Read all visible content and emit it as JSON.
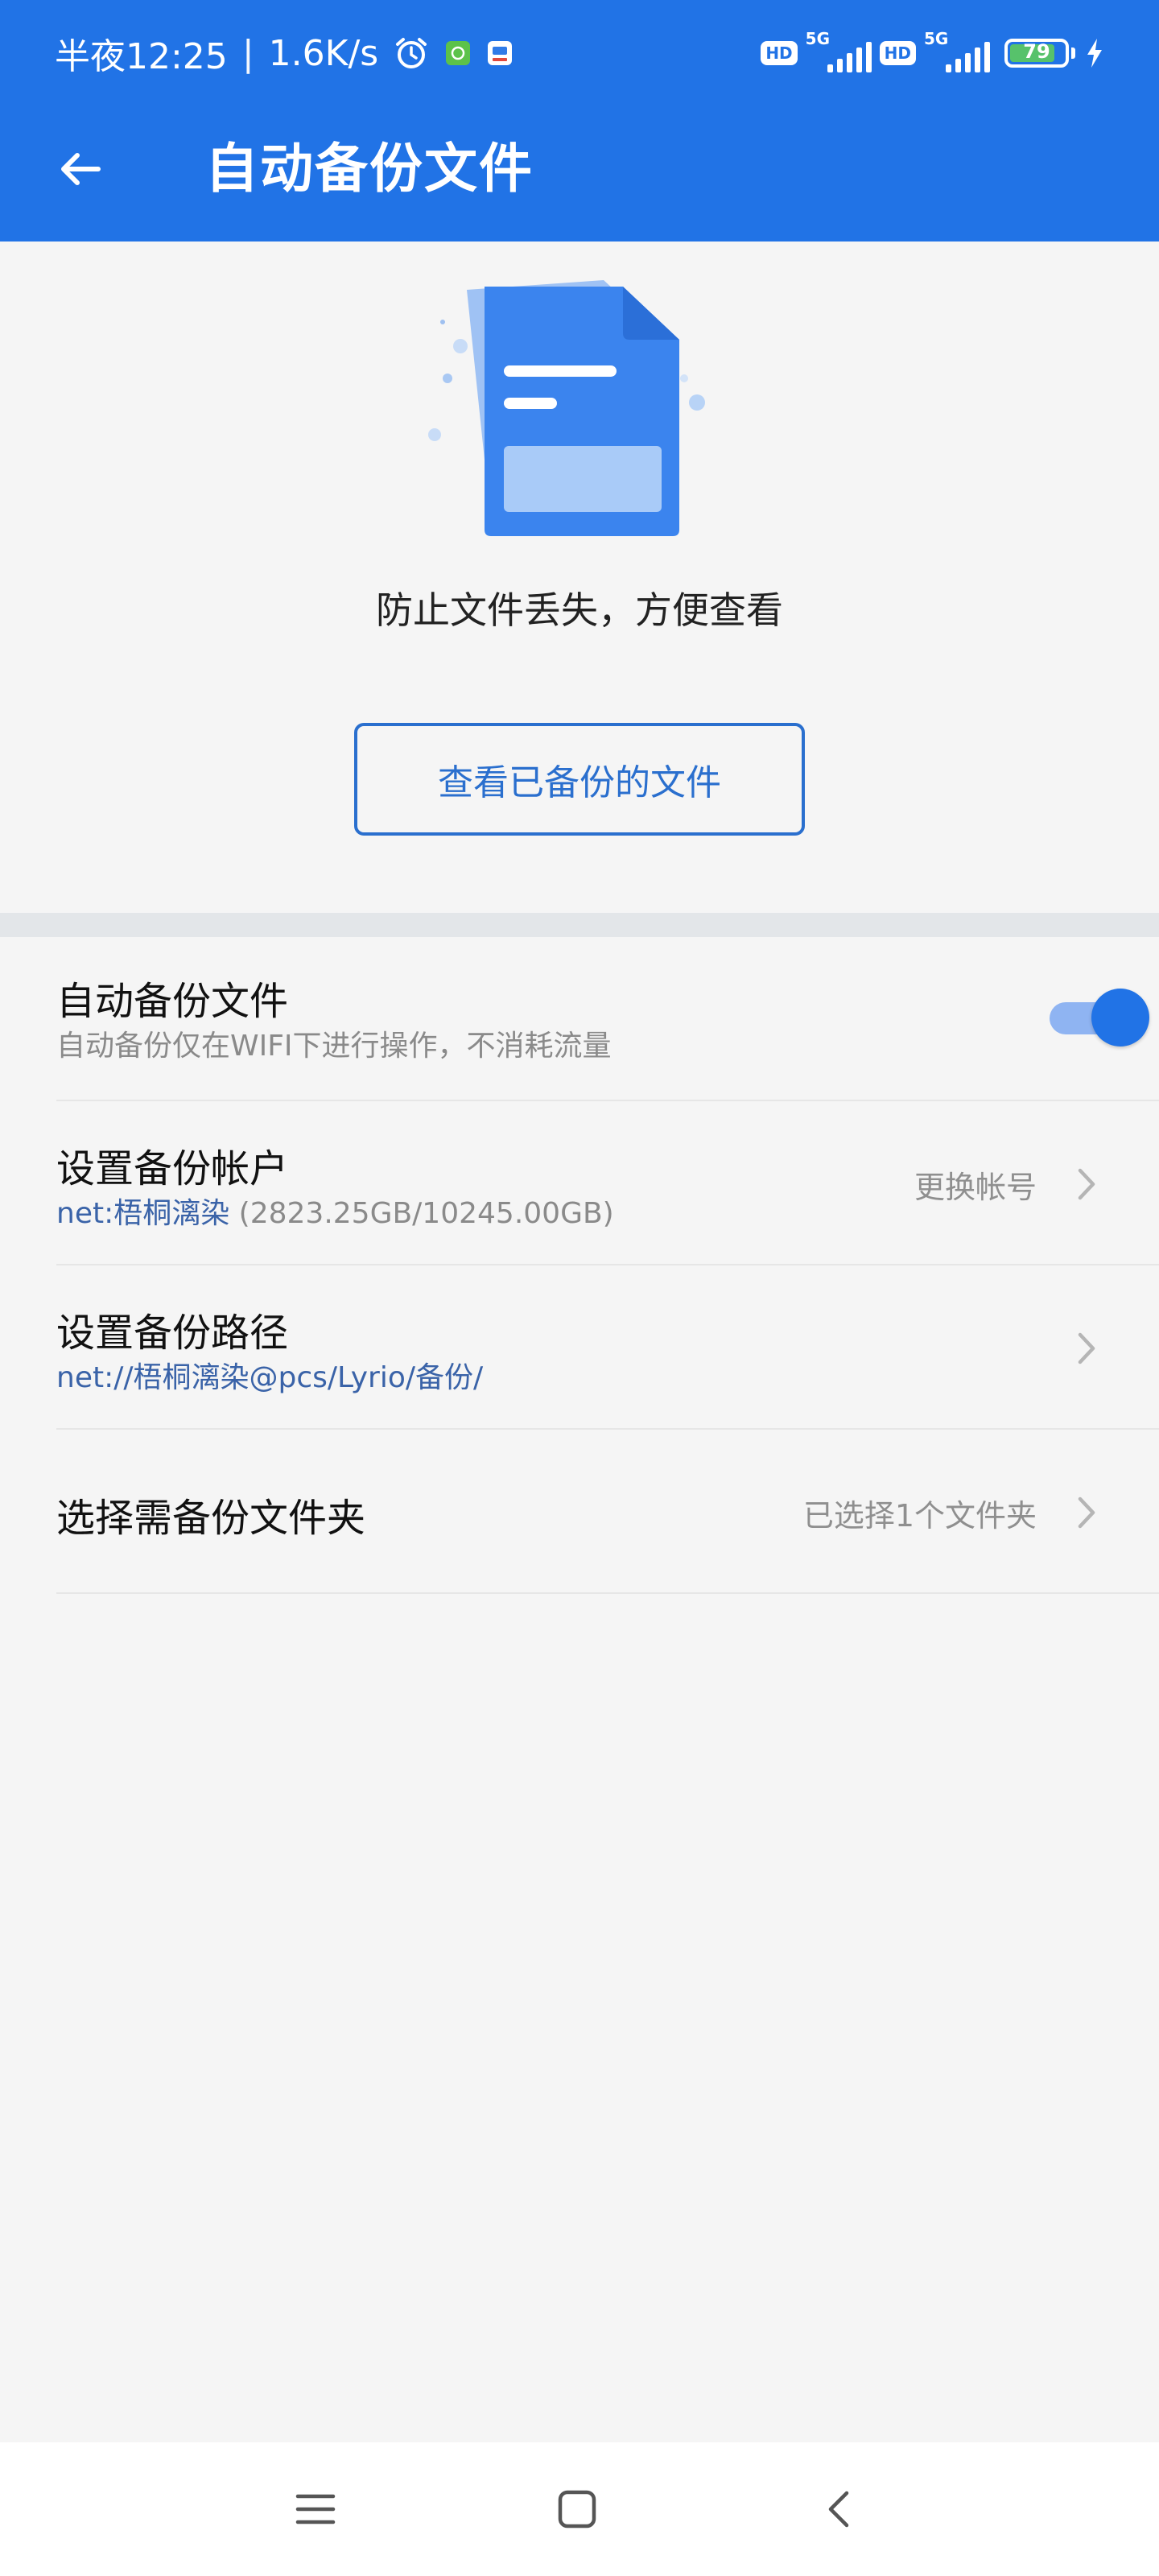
{
  "status_bar": {
    "time": "半夜12:25",
    "separator": "|",
    "speed": "1.6K/s",
    "hd_label": "HD",
    "network_label": "5G",
    "battery": "79",
    "icons": [
      "alarm-icon",
      "app-notification-icon",
      "app-notification-icon",
      "hd-icon",
      "5g-signal-icon",
      "hd-icon",
      "5g-signal-icon",
      "battery-icon",
      "charging-icon"
    ]
  },
  "app_bar": {
    "back_icon": "arrow-left-icon",
    "title": "自动备份文件"
  },
  "hero": {
    "illustration": "document-illustration",
    "tagline": "防止文件丢失，方便查看",
    "view_button": "查看已备份的文件"
  },
  "settings": {
    "auto_backup": {
      "title": "自动备份文件",
      "subtitle": "自动备份仅在WIFI下进行操作，不消耗流量",
      "enabled": true
    },
    "account": {
      "title": "设置备份帐户",
      "account_name": "net:梧桐漓染",
      "capacity": " (2823.25GB/10245.00GB)",
      "action": "更换帐号"
    },
    "path": {
      "title": "设置备份路径",
      "value": "net://梧桐漓染@pcs/Lyrio/备份/"
    },
    "folders": {
      "title": "选择需备份文件夹",
      "value": "已选择1个文件夹"
    }
  },
  "nav_bar": {
    "icons": [
      "menu-icon",
      "home-icon",
      "back-icon"
    ]
  },
  "colors": {
    "primary": "#2173e6",
    "link": "#3a63a8",
    "background": "#f5f5f5",
    "divider": "#e3e6e9"
  }
}
